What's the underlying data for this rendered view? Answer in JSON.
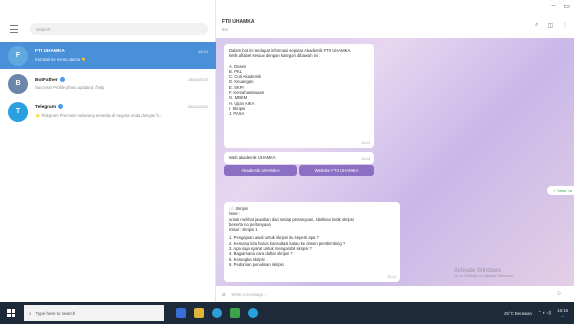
{
  "window": {
    "minimize": "–",
    "maximize": "▭"
  },
  "sidebar": {
    "search_placeholder": "Search",
    "chats": [
      {
        "name": "FTI UHAMKA",
        "preview": "Kembali ke menu utama 👇",
        "time": "15:14",
        "avatar_color": "#5fa8e0",
        "avatar_letter": "F"
      },
      {
        "name": "BotFather",
        "preview": "Success! Profile photo updated. /help",
        "time": "28/04/2022",
        "avatar_color": "#6b86a8",
        "avatar_letter": "B"
      },
      {
        "name": "Telegram",
        "preview": "⭐ Telegram Premium sekarang tersedia di negara Anda dengan h...",
        "time": "28/12/2022",
        "avatar_color": "#2aa1df",
        "avatar_letter": "T"
      }
    ]
  },
  "header": {
    "title": "FTII UHAMKA",
    "subtitle": "bot"
  },
  "messages": {
    "intro_lines": [
      "Dalam bot ini terdapat informasi seputar Akademik FTII UHAMKA.",
      "ketik alfabet sesuai dengan kategori dibawah ini :",
      "",
      "A. Dosen",
      "B. PKL",
      "C. Cuti Akademik",
      "D. Keuangan",
      "E. SKPI",
      "F. Kemahasiswaan",
      "G. MBKM",
      "H. Ujian AIKA",
      "I. Skripsi",
      "J. PASA"
    ],
    "intro_time": "15:14",
    "reply_text": "Web akademik UHAMKA",
    "reply_time": "15:14",
    "buttons": [
      "Akademik UHAMKA",
      "Website FTII UHAMKA"
    ],
    "pill": "✓ hese, ur",
    "skripsi_lines": [
      "📄 Skripsi",
      "Note :",
      "untuk melihat jawaban dari setiap pertanyaan, silahkan ketik skripsi",
      "beserta no pertanyaan",
      "misal : skripsi 1",
      "",
      "1. Pengajuan awal untuk skripsi itu seperti apa ?",
      "2. Kemana kita harus konsultasi kalau ke dosen pembimbing ?",
      "3. Apa saja syarat untuk mengambil skripsi ?",
      "4. Bagaimana cara daftar skripsi ?",
      "5. Kerangka skripsi",
      "6. Pedoman penulisan skripsi"
    ],
    "skripsi_time": "15:14"
  },
  "input": {
    "placeholder": "Write a message..."
  },
  "watermark": {
    "title": "Activate Windows",
    "subtitle": "Go to Settings to activate Windows."
  },
  "taskbar": {
    "search_placeholder": "Type here to search",
    "weather": "25°C Berawan",
    "time": "15:15",
    "date": "..."
  },
  "colors": {
    "accent": "#4a90d9",
    "button": "#8a6fc2",
    "taskbar": "#1c2a3a"
  }
}
